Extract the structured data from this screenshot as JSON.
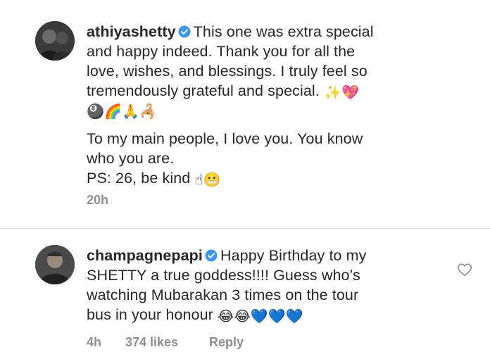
{
  "post": {
    "username": "athiyashetty",
    "caption_line1": "This one was extra special",
    "caption_line2": "and happy indeed. Thank you for all the",
    "caption_line3": "love, wishes, and blessings. I truly feel so",
    "caption_line4": "tremendously grateful  and special.",
    "caption_line4_emoji": "✨💖",
    "emoji_row": "🎱🌈🙏🦂",
    "caption_line5": "To my main people, I love you. You know",
    "caption_line6": "who you are.",
    "caption_line7": "PS: 26, be kind",
    "caption_line7_emoji": "☝😬",
    "time": "20h"
  },
  "comment": {
    "username": "champagnepapi",
    "text_line1": "Happy Birthday to my",
    "text_line2": "SHETTY a true goddess!!!! Guess who’s",
    "text_line3": "watching Mubarakan 3 times on the tour",
    "text_line4": "bus in your honour",
    "text_line4_emoji": "😂😂💙💙💙",
    "time": "4h",
    "likes": "374 likes",
    "reply_label": "Reply"
  },
  "colors": {
    "text": "#262626",
    "meta": "#8e8e8e",
    "verified": "#3897f0",
    "divider": "#dbdbdb"
  },
  "icons": [
    "verified-badge-icon",
    "heart-outline-icon"
  ]
}
